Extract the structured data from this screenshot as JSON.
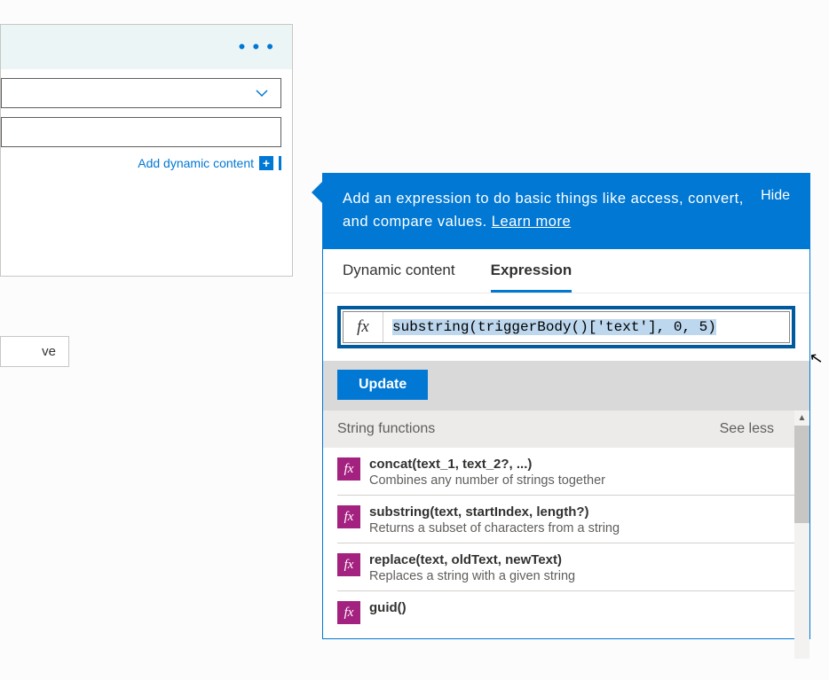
{
  "action_card": {
    "more_menu_label": "More options",
    "add_dynamic_link": "Add dynamic content",
    "add_dynamic_icon": "+"
  },
  "save_button_label": "ve",
  "flyout": {
    "banner_text": "Add an expression to do basic things like access, convert, and compare values. ",
    "learn_more": "Learn more",
    "hide": "Hide",
    "tabs": {
      "dynamic": "Dynamic content",
      "expression": "Expression"
    },
    "fx_label": "fx",
    "expression_value": "substring(triggerBody()['text'], 0, 5)",
    "update_label": "Update"
  },
  "section": {
    "title": "String functions",
    "see_less": "See less"
  },
  "functions": [
    {
      "signature": "concat(text_1, text_2?, ...)",
      "description": "Combines any number of strings together"
    },
    {
      "signature": "substring(text, startIndex, length?)",
      "description": "Returns a subset of characters from a string"
    },
    {
      "signature": "replace(text, oldText, newText)",
      "description": "Replaces a string with a given string"
    },
    {
      "signature": "guid()",
      "description": ""
    }
  ]
}
